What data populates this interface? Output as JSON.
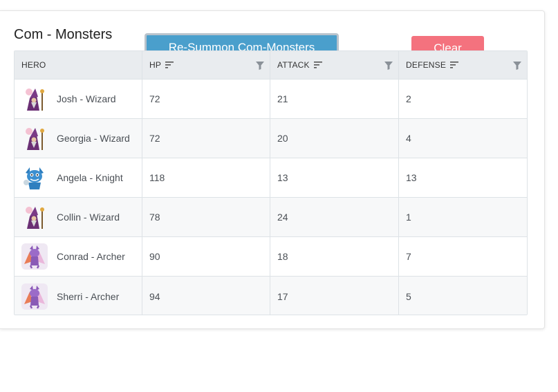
{
  "panel": {
    "title": "Com - Monsters",
    "summon_label": "Re-Summon Com-Monsters",
    "clear_label": "Clear"
  },
  "grid": {
    "columns": [
      "HERO",
      "HP",
      "ATTACK",
      "DEFENSE"
    ],
    "rows": [
      {
        "hero": "Josh - Wizard",
        "icon": "wizard-icon",
        "hp": "72",
        "attack": "21",
        "defense": "2"
      },
      {
        "hero": "Georgia - Wizard",
        "icon": "wizard-icon",
        "hp": "72",
        "attack": "20",
        "defense": "4"
      },
      {
        "hero": "Angela - Knight",
        "icon": "knight-icon",
        "hp": "118",
        "attack": "13",
        "defense": "13"
      },
      {
        "hero": "Collin - Wizard",
        "icon": "wizard-icon",
        "hp": "78",
        "attack": "24",
        "defense": "1"
      },
      {
        "hero": "Conrad - Archer",
        "icon": "archer-icon",
        "hp": "90",
        "attack": "18",
        "defense": "7"
      },
      {
        "hero": "Sherri - Archer",
        "icon": "archer-icon",
        "hp": "94",
        "attack": "17",
        "defense": "5"
      }
    ]
  },
  "colors": {
    "summon_button": "#4a9fcc",
    "clear_button": "#f4727e",
    "header_bg": "#e9ecef"
  }
}
